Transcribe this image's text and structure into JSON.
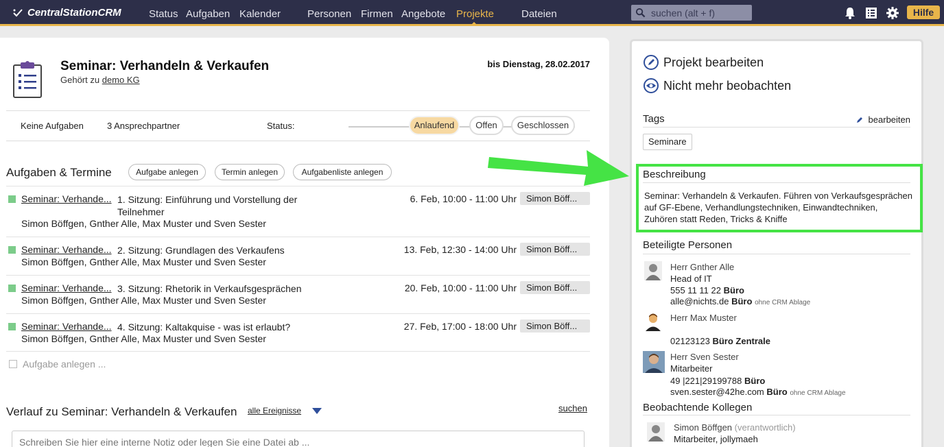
{
  "nav": {
    "logo": "CentralStationCRM",
    "items": [
      "Status",
      "Aufgaben",
      "Kalender",
      "Personen",
      "Firmen",
      "Angebote",
      "Projekte",
      "Dateien"
    ],
    "active": "Projekte",
    "search_placeholder": "suchen (alt + f)",
    "help": "Hilfe",
    "colors": {
      "bar": "#2d2f49",
      "accent": "#e8b54a"
    }
  },
  "project": {
    "title": "Seminar: Verhandeln & Verkaufen",
    "belongs_prefix": "Gehört zu",
    "company": "demo KG",
    "due": "bis Dienstag, 28.02.2017",
    "no_tasks": "Keine Aufgaben",
    "contacts": "3 Ansprechpartner",
    "status_label": "Status:",
    "status_options": [
      "Anlaufend",
      "Offen",
      "Geschlossen"
    ],
    "status_active": "Anlaufend"
  },
  "tasks_section": {
    "title": "Aufgaben & Termine",
    "buttons": [
      "Aufgabe anlegen",
      "Termin anlegen",
      "Aufgabenliste anlegen"
    ],
    "tasks": [
      {
        "link": "Seminar: Verhande...",
        "desc": "1. Sitzung: Einführung und Vorstellung der Teilnehmer",
        "people": "Simon Böffgen, Gnther Alle, Max Muster und Sven Sester",
        "time": "6. Feb, 10:00 - 11:00 Uhr",
        "owner": "Simon Böff..."
      },
      {
        "link": "Seminar: Verhande...",
        "desc": "2. Sitzung: Grundlagen des Verkaufens",
        "people": "Simon Böffgen, Gnther Alle, Max Muster und Sven Sester",
        "time": "13. Feb, 12:30 - 14:00 Uhr",
        "owner": "Simon Böff..."
      },
      {
        "link": "Seminar: Verhande...",
        "desc": "3. Sitzung: Rhetorik in Verkaufsgesprächen",
        "people": "Simon Böffgen, Gnther Alle, Max Muster und Sven Sester",
        "time": "20. Feb, 10:00 - 11:00 Uhr",
        "owner": "Simon Böff..."
      },
      {
        "link": "Seminar: Verhande...",
        "desc": "4. Sitzung: Kaltakquise - was ist erlaubt?",
        "people": "Simon Böffgen, Gnther Alle, Max Muster und Sven Sester",
        "time": "27. Feb, 17:00 - 18:00 Uhr",
        "owner": "Simon Böff..."
      }
    ],
    "new_task": "Aufgabe anlegen ..."
  },
  "history": {
    "title": "Verlauf zu Seminar: Verhandeln & Verkaufen",
    "filter": "alle Ereignisse",
    "search": "suchen",
    "note_placeholder": "Schreiben Sie hier eine interne Notiz oder legen Sie eine Datei ab ..."
  },
  "sidebar": {
    "edit_project": "Projekt bearbeiten",
    "unwatch": "Nicht mehr beobachten",
    "tags_title": "Tags",
    "tags_edit": "bearbeiten",
    "tags": [
      "Seminare"
    ],
    "desc_title": "Beschreibung",
    "description": "Seminar: Verhandeln & Verkaufen. Führen von Verkaufsgesprächen auf GF-Ebene, Verhandlungstechniken, Einwandtechniken, Zuhören statt Reden, Tricks & Kniffe",
    "people_title": "Beteiligte Personen",
    "people": [
      {
        "name": "Herr Gnther Alle",
        "role": "Head of IT",
        "phone": "555 11 11 22",
        "phone_type": "Büro",
        "email": "alle@nichts.de",
        "email_type": "Büro",
        "email_note": "ohne CRM Ablage"
      },
      {
        "name": "Herr Max Muster",
        "phone": "02123123",
        "phone_type": "Büro Zentrale"
      },
      {
        "name": "Herr Sven Sester",
        "role": "Mitarbeiter",
        "phone": "49 |221|29199788",
        "phone_type": "Büro",
        "email": "sven.sester@42he.com",
        "email_type": "Büro",
        "email_note": "ohne CRM Ablage"
      }
    ],
    "watchers_title": "Beobachtende Kollegen",
    "watchers": [
      {
        "name": "Simon Böffgen",
        "tag": "(verantwortlich)",
        "role": "Mitarbeiter, jollymaeh"
      }
    ],
    "highlight_color": "#45e345"
  }
}
